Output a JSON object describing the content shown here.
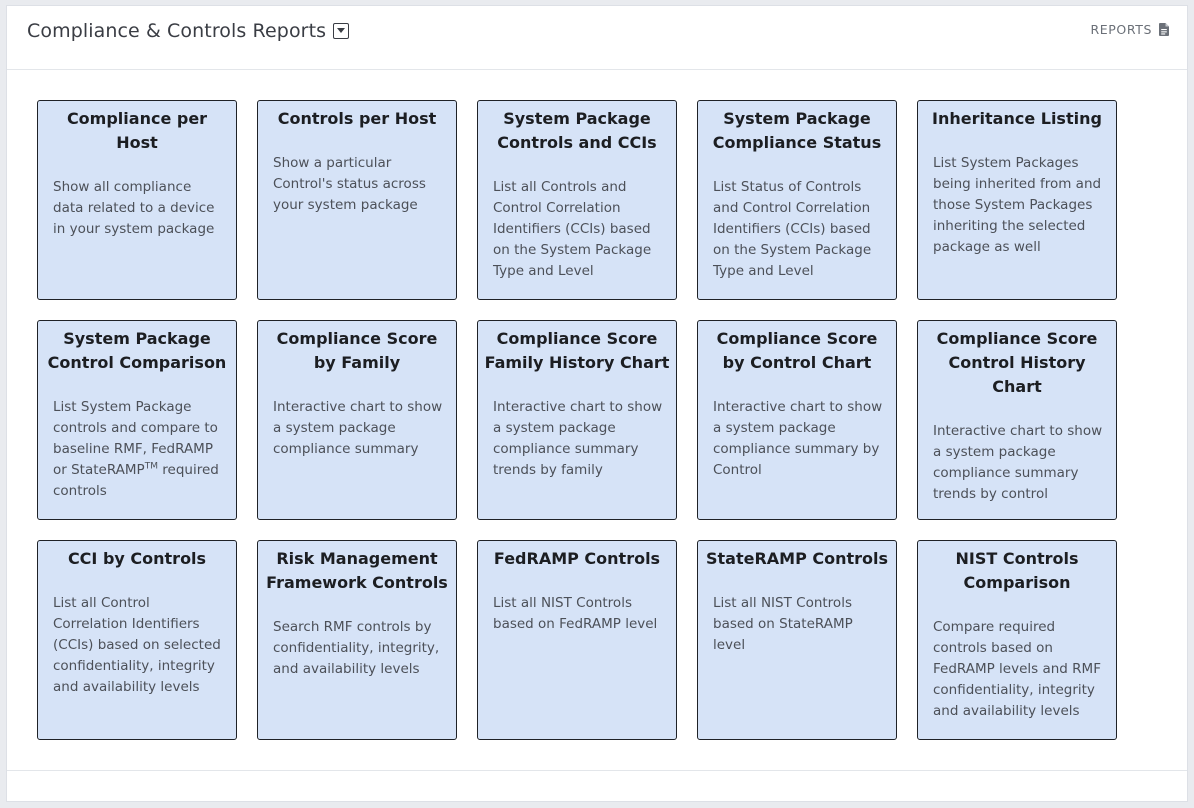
{
  "header": {
    "title": "Compliance & Controls Reports",
    "reports_label": "REPORTS"
  },
  "cards": [
    {
      "title": "Compliance per Host",
      "desc": "Show all compliance data related to a device in your system package"
    },
    {
      "title": "Controls per Host",
      "desc": "Show a particular Control's status across your system package"
    },
    {
      "title": "System Package Controls and CCIs",
      "desc": "List all Controls and Control Correlation Identifiers (CCIs) based on the System Package Type and Level"
    },
    {
      "title": "System Package Compliance Status",
      "desc": "List Status of Controls and Control Correlation Identifiers (CCIs) based on the System Package Type and Level"
    },
    {
      "title": "Inheritance Listing",
      "desc": "List System Packages being inherited from and those System Packages inheriting the selected package as well"
    },
    {
      "title": "System Package Control Comparison",
      "desc_pre": "List System Package controls and compare to baseline RMF, FedRAMP or StateRAMP",
      "desc_sup": "TM",
      "desc_post": " required controls"
    },
    {
      "title": "Compliance Score by Family",
      "desc": "Interactive chart to show a system package compliance summary"
    },
    {
      "title": "Compliance Score Family History Chart",
      "desc": "Interactive chart to show a system package compliance summary trends by family"
    },
    {
      "title": "Compliance Score by Control Chart",
      "desc": "Interactive chart to show a system package compliance summary by Control"
    },
    {
      "title": "Compliance Score Control History Chart",
      "desc": "Interactive chart to show a system package compliance summary trends by control"
    },
    {
      "title": "CCI by Controls",
      "desc": "List all Control Correlation Identifiers (CCIs) based on selected confidentiality, integrity and availability levels"
    },
    {
      "title": "Risk Management Framework Controls",
      "desc": "Search RMF controls by confidentiality, integrity, and availability levels"
    },
    {
      "title": "FedRAMP Controls",
      "desc": "List all NIST Controls based on FedRAMP level"
    },
    {
      "title": "StateRAMP Controls",
      "desc": "List all NIST Controls based on StateRAMP level"
    },
    {
      "title": "NIST Controls Comparison",
      "desc": "Compare required controls based on FedRAMP levels and RMF confidentiality, integrity and availability levels"
    }
  ]
}
